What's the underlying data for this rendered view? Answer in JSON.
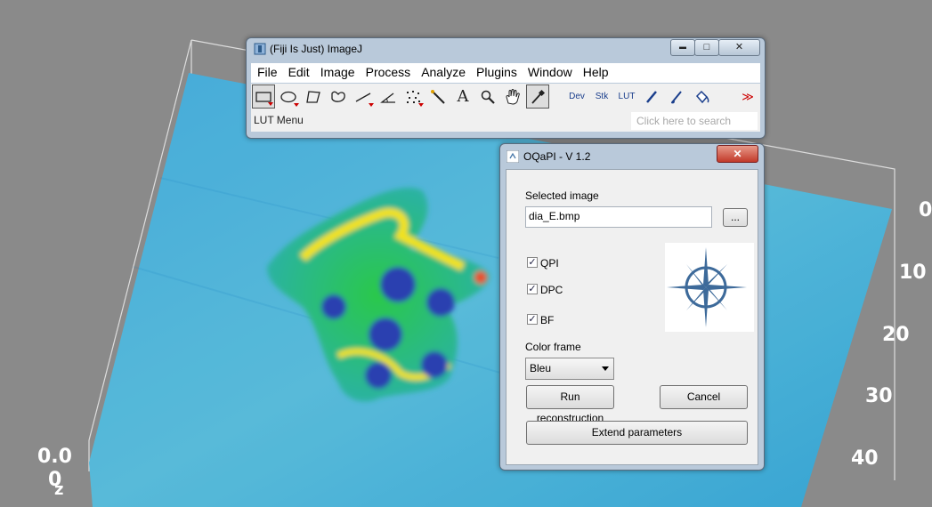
{
  "background": {
    "axis_labels": [
      "0",
      "10",
      "20",
      "30",
      "40",
      "0.0",
      "0",
      "z"
    ]
  },
  "imagej": {
    "title": "(Fiji Is Just) ImageJ",
    "window_buttons": {
      "minimize": "▬",
      "maximize": "□",
      "close": "✕"
    },
    "menus": [
      "File",
      "Edit",
      "Image",
      "Process",
      "Analyze",
      "Plugins",
      "Window",
      "Help"
    ],
    "tools": {
      "text_tool": "A",
      "dev": "Dev",
      "stk": "Stk",
      "lut": "LUT",
      "more": "≫"
    },
    "status": "LUT Menu",
    "search_placeholder": "Click here to search"
  },
  "oqapi": {
    "title": "OQaPI - V 1.2",
    "close": "✕",
    "selected_image_label": "Selected image",
    "selected_image_value": "dia_E.bmp",
    "browse_label": "...",
    "checkboxes": [
      {
        "label": "QPI",
        "checked": true
      },
      {
        "label": "DPC",
        "checked": true
      },
      {
        "label": "BF",
        "checked": true
      }
    ],
    "color_frame_label": "Color frame",
    "color_frame_value": "Bleu",
    "run_label": "Run reconstruction",
    "cancel_label": "Cancel",
    "extend_label": "Extend parameters"
  },
  "colors": {
    "surface_low": "#1a8fd0",
    "surface_mid": "#2bd14a",
    "surface_high": "#f2e21c",
    "surface_peak": "#e8502a",
    "window_frame": "#b9c9da"
  }
}
